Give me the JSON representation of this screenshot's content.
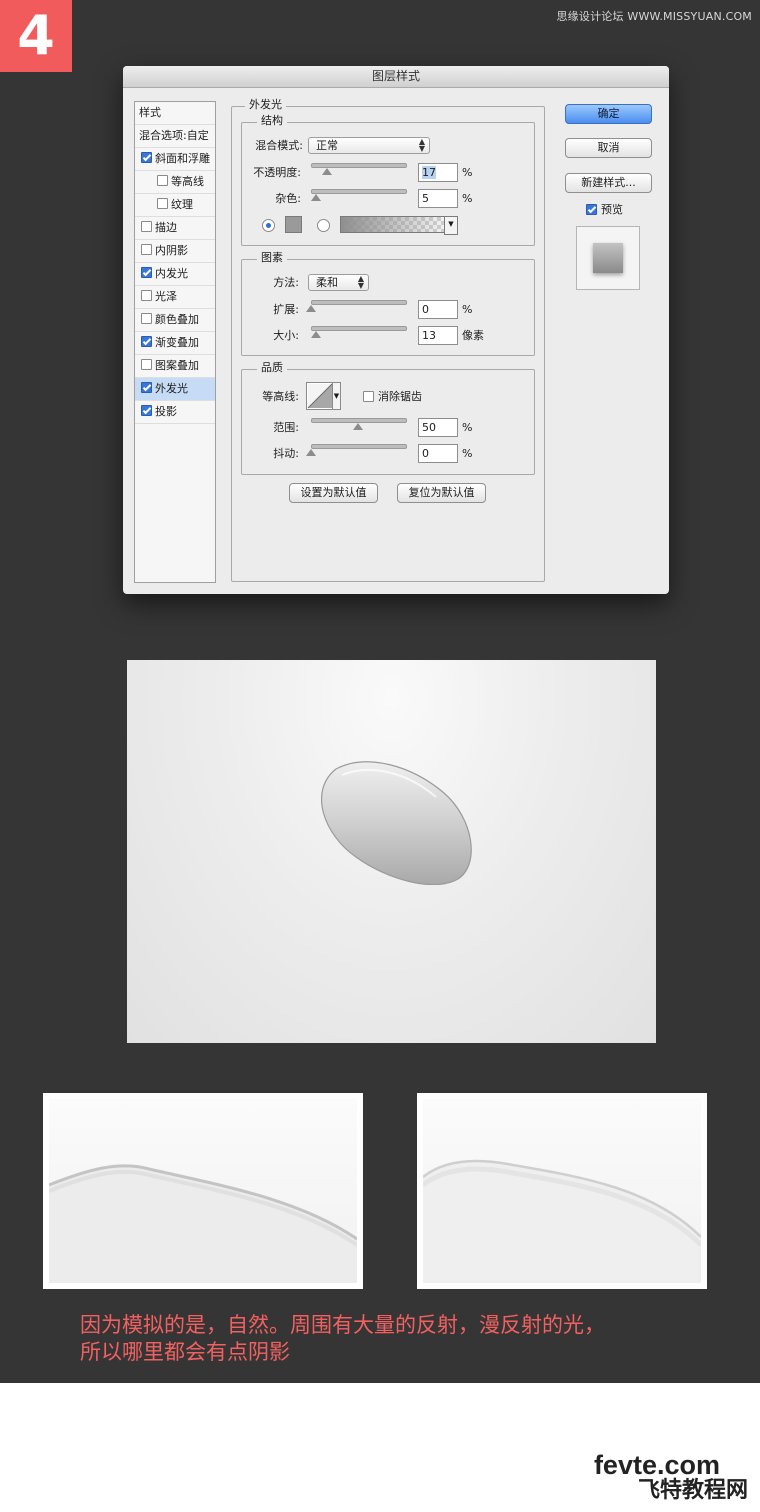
{
  "page": {
    "step_number": "4",
    "top_watermark": "思缘设计论坛 WWW.MISSYUAN.COM",
    "caption_lines": [
      "因为模拟的是，自然。周围有大量的反射，漫反射的光，",
      "所以哪里都会有点阴影"
    ],
    "bottom_watermark_en": "fevte.com",
    "bottom_watermark_cn": "飞特教程网",
    "colors": {
      "background": "#353535",
      "accent": "#f25b5b",
      "caption": "#f26060"
    }
  },
  "dialog": {
    "title": "图层样式",
    "style_list": {
      "header": "样式",
      "blend_options": "混合选项:自定",
      "items": [
        {
          "label": "斜面和浮雕",
          "checked": true,
          "indent": false,
          "selected": false
        },
        {
          "label": "等高线",
          "checked": false,
          "indent": true,
          "selected": false
        },
        {
          "label": "纹理",
          "checked": false,
          "indent": true,
          "selected": false
        },
        {
          "label": "描边",
          "checked": false,
          "indent": false,
          "selected": false
        },
        {
          "label": "内阴影",
          "checked": false,
          "indent": false,
          "selected": false
        },
        {
          "label": "内发光",
          "checked": true,
          "indent": false,
          "selected": false
        },
        {
          "label": "光泽",
          "checked": false,
          "indent": false,
          "selected": false
        },
        {
          "label": "颜色叠加",
          "checked": false,
          "indent": false,
          "selected": false
        },
        {
          "label": "渐变叠加",
          "checked": true,
          "indent": false,
          "selected": false
        },
        {
          "label": "图案叠加",
          "checked": false,
          "indent": false,
          "selected": false
        },
        {
          "label": "外发光",
          "checked": true,
          "indent": false,
          "selected": true
        },
        {
          "label": "投影",
          "checked": true,
          "indent": false,
          "selected": false
        }
      ]
    },
    "panel_title": "外发光",
    "structure": {
      "title": "结构",
      "blend_mode_label": "混合模式:",
      "blend_mode_value": "正常",
      "opacity_label": "不透明度:",
      "opacity_value": "17",
      "opacity_unit": "%",
      "opacity_level": 0.17,
      "noise_label": "杂色:",
      "noise_value": "5",
      "noise_unit": "%",
      "noise_level": 0.05,
      "color_swatch": "#9a9a9a"
    },
    "elements": {
      "title": "图素",
      "technique_label": "方法:",
      "technique_value": "柔和",
      "spread_label": "扩展:",
      "spread_value": "0",
      "spread_unit": "%",
      "spread_level": 0.0,
      "size_label": "大小:",
      "size_value": "13",
      "size_unit": "像素",
      "size_level": 0.05
    },
    "quality": {
      "title": "品质",
      "contour_label": "等高线:",
      "anti_alias_label": "消除锯齿",
      "range_label": "范围:",
      "range_value": "50",
      "range_unit": "%",
      "range_level": 0.5,
      "jitter_label": "抖动:",
      "jitter_value": "0",
      "jitter_unit": "%",
      "jitter_level": 0.0
    },
    "make_default_button": "设置为默认值",
    "reset_default_button": "复位为默认值",
    "ok_button": "确定",
    "cancel_button": "取消",
    "new_style_button": "新建样式...",
    "preview_label": "预览",
    "preview_checked": true
  }
}
